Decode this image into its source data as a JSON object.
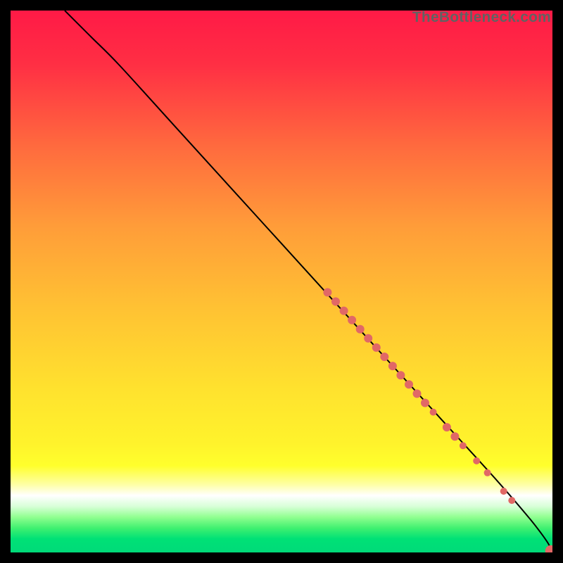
{
  "watermark": {
    "text": "TheBottleneck.com"
  },
  "gradient_stops": [
    {
      "offset": 0.0,
      "color": "#ff1a46"
    },
    {
      "offset": 0.1,
      "color": "#ff2f44"
    },
    {
      "offset": 0.25,
      "color": "#ff6a3e"
    },
    {
      "offset": 0.4,
      "color": "#ff9d39"
    },
    {
      "offset": 0.55,
      "color": "#ffc233"
    },
    {
      "offset": 0.7,
      "color": "#ffe22e"
    },
    {
      "offset": 0.8,
      "color": "#fff32c"
    },
    {
      "offset": 0.84,
      "color": "#ffff2c"
    },
    {
      "offset": 0.875,
      "color": "#feffa6"
    },
    {
      "offset": 0.895,
      "color": "#ffffff"
    },
    {
      "offset": 0.915,
      "color": "#d8ffd8"
    },
    {
      "offset": 0.935,
      "color": "#90ff90"
    },
    {
      "offset": 0.955,
      "color": "#40f070"
    },
    {
      "offset": 0.975,
      "color": "#00e176"
    },
    {
      "offset": 1.0,
      "color": "#00da79"
    }
  ],
  "chart_data": {
    "type": "line",
    "title": "",
    "xlabel": "",
    "ylabel": "",
    "xlim": [
      0,
      100
    ],
    "ylim": [
      0,
      100
    ],
    "series": [
      {
        "name": "curve",
        "x": [
          10,
          12,
          15,
          20,
          30,
          40,
          50,
          60,
          70,
          80,
          90,
          96,
          99,
          100
        ],
        "y": [
          100,
          98,
          95,
          90,
          79,
          68,
          57,
          46,
          35,
          24,
          13,
          6,
          2,
          0
        ]
      }
    ],
    "scatter": {
      "name": "markers",
      "color": "#e16866",
      "points": [
        {
          "x": 58.5,
          "y": 48.0,
          "r": 6
        },
        {
          "x": 60.0,
          "y": 46.3,
          "r": 6
        },
        {
          "x": 61.5,
          "y": 44.6,
          "r": 6
        },
        {
          "x": 63.0,
          "y": 42.9,
          "r": 6
        },
        {
          "x": 64.5,
          "y": 41.2,
          "r": 6
        },
        {
          "x": 66.0,
          "y": 39.5,
          "r": 6
        },
        {
          "x": 67.5,
          "y": 37.8,
          "r": 6
        },
        {
          "x": 69.0,
          "y": 36.1,
          "r": 6
        },
        {
          "x": 70.5,
          "y": 34.4,
          "r": 6
        },
        {
          "x": 72.0,
          "y": 32.7,
          "r": 6
        },
        {
          "x": 73.5,
          "y": 31.0,
          "r": 6
        },
        {
          "x": 75.0,
          "y": 29.3,
          "r": 6
        },
        {
          "x": 76.5,
          "y": 27.6,
          "r": 6
        },
        {
          "x": 78.0,
          "y": 25.9,
          "r": 5
        },
        {
          "x": 80.5,
          "y": 23.1,
          "r": 6
        },
        {
          "x": 82.0,
          "y": 21.4,
          "r": 6
        },
        {
          "x": 83.5,
          "y": 19.7,
          "r": 5
        },
        {
          "x": 86.0,
          "y": 16.9,
          "r": 5
        },
        {
          "x": 88.0,
          "y": 14.7,
          "r": 5
        },
        {
          "x": 91.0,
          "y": 11.3,
          "r": 5
        },
        {
          "x": 92.5,
          "y": 9.6,
          "r": 5
        },
        {
          "x": 99.7,
          "y": 0.3,
          "r": 8
        },
        {
          "x": 100.5,
          "y": -0.5,
          "r": 6
        }
      ]
    }
  }
}
